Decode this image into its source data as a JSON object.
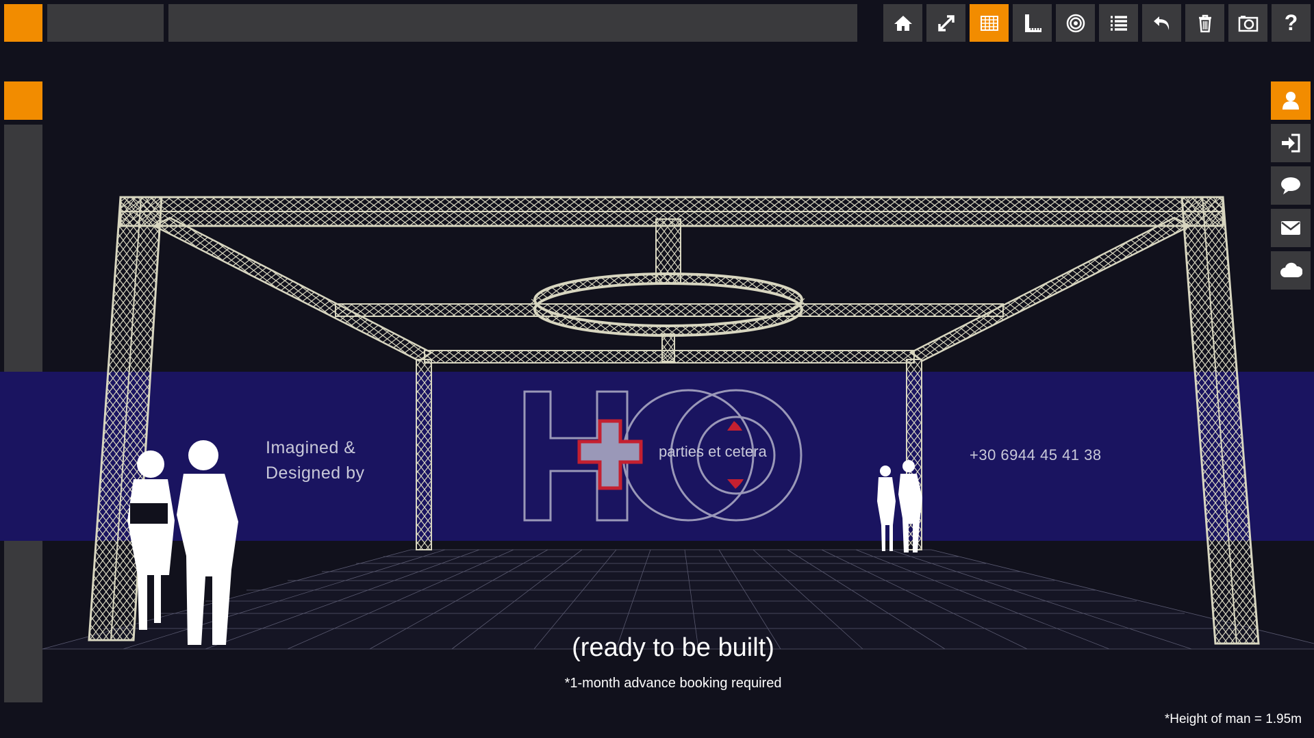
{
  "toolbar": {
    "buttons": [
      {
        "icon": "home-icon",
        "active": false
      },
      {
        "icon": "expand-icon",
        "active": false
      },
      {
        "icon": "grid-icon",
        "active": true
      },
      {
        "icon": "ruler-icon",
        "active": false
      },
      {
        "icon": "target-icon",
        "active": false
      },
      {
        "icon": "list-icon",
        "active": false
      },
      {
        "icon": "undo-icon",
        "active": false
      },
      {
        "icon": "trash-icon",
        "active": false
      },
      {
        "icon": "camera-icon",
        "active": false
      },
      {
        "icon": "help-icon",
        "active": false
      }
    ],
    "help_label": "?"
  },
  "right_panel": {
    "buttons": [
      {
        "icon": "user-icon",
        "active": true
      },
      {
        "icon": "login-icon",
        "active": false
      },
      {
        "icon": "chat-icon",
        "active": false
      },
      {
        "icon": "mail-icon",
        "active": false
      },
      {
        "icon": "cloud-icon",
        "active": false
      }
    ]
  },
  "scene": {
    "imagined_line1": "Imagined &",
    "imagined_line2": "Designed by",
    "brand_tagline": "parties et cetera",
    "phone": "+30 6944 45 41 38",
    "ready_text": "(ready to be built)",
    "booking_text": "*1-month advance booking required",
    "height_note": "*Height of man = 1.95m"
  },
  "colors": {
    "accent": "#f28c00",
    "panel": "#3a3a3d",
    "background": "#11111c",
    "wall": "#1a1460",
    "truss": "#d8d6c0"
  }
}
